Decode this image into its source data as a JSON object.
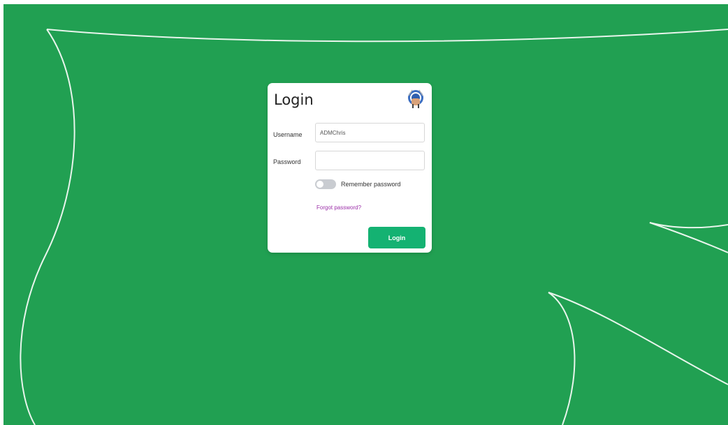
{
  "login_card": {
    "title": "Login",
    "logo_icon": "badge-logo-icon",
    "username": {
      "label": "Username",
      "value": "ADMChris"
    },
    "password": {
      "label": "Password",
      "value": ""
    },
    "remember": {
      "label": "Remember password",
      "checked": false
    },
    "forgot_link": "Forgot password?",
    "submit_label": "Login"
  },
  "colors": {
    "background": "#21a052",
    "accent_button": "#14b272",
    "link": "#9b2fa8"
  }
}
